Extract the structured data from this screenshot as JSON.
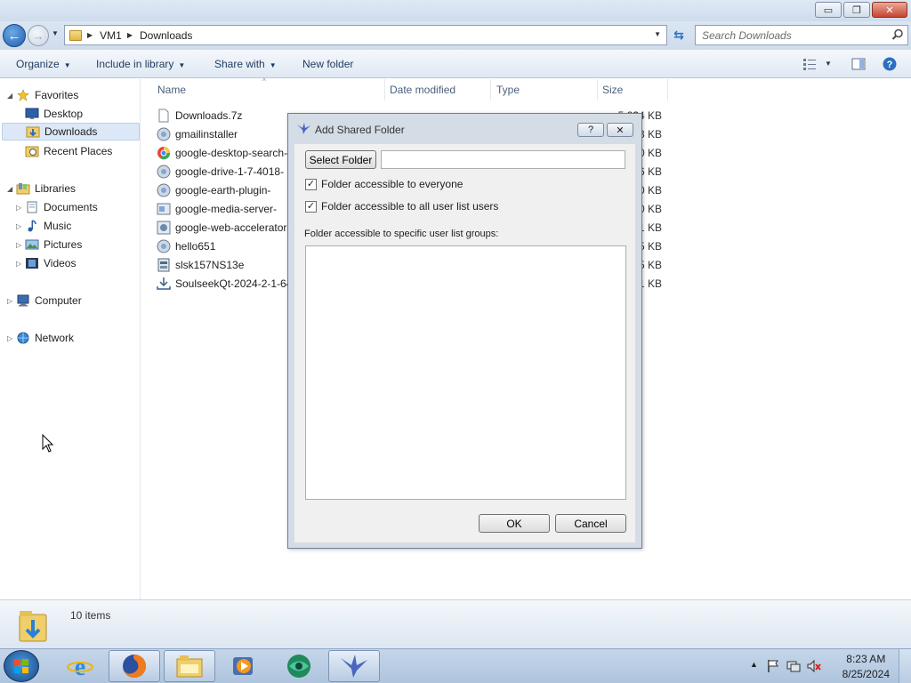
{
  "window": {
    "minimize": "▭",
    "maximize": "❐",
    "close": "✕"
  },
  "address": {
    "crumbs": [
      "VM1",
      "Downloads"
    ],
    "search_placeholder": "Search Downloads"
  },
  "toolbar": {
    "organize": "Organize",
    "include_in_library": "Include in library",
    "share_with": "Share with",
    "new_folder": "New folder"
  },
  "sidebar": {
    "favorites": "Favorites",
    "desktop": "Desktop",
    "downloads": "Downloads",
    "recent_places": "Recent Places",
    "libraries": "Libraries",
    "documents": "Documents",
    "music": "Music",
    "pictures": "Pictures",
    "videos": "Videos",
    "computer": "Computer",
    "network": "Network"
  },
  "columns": {
    "name": "Name",
    "date_modified": "Date modified",
    "type": "Type",
    "size": "Size"
  },
  "files": [
    {
      "name": "Downloads.7z",
      "size": "5,2?4 KB"
    },
    {
      "name": "gmailinstaller",
      "size": "3 KB"
    },
    {
      "name": "google-desktop-search-",
      "size": "0 KB"
    },
    {
      "name": "google-drive-1-7-4018-",
      "size": "6 KB"
    },
    {
      "name": "google-earth-plugin-",
      "size": "0 KB"
    },
    {
      "name": "google-media-server-",
      "size": "0 KB"
    },
    {
      "name": "google-web-accelerator",
      "size": "1 KB"
    },
    {
      "name": "hello651",
      "size": "5 KB"
    },
    {
      "name": "slsk157NS13e",
      "size": "5 KB"
    },
    {
      "name": "SoulseekQt-2024-2-1-64",
      "size": "1 KB"
    }
  ],
  "dialog": {
    "title": "Add Shared Folder",
    "help": "?",
    "close": "✕",
    "select_folder": "Select Folder",
    "folder_path": "",
    "check_everyone": "Folder accessible to everyone",
    "check_everyone_checked": true,
    "check_all_users": "Folder accessible to all user list users",
    "check_all_users_checked": true,
    "groups_label": "Folder accessible to specific user list groups:",
    "ok": "OK",
    "cancel": "Cancel"
  },
  "status": {
    "item_count": "10 items"
  },
  "taskbar": {
    "time": "8:23 AM",
    "date": "8/25/2024"
  },
  "colors": {
    "accent": "#1d5fae",
    "selection": "#dce8f7"
  }
}
